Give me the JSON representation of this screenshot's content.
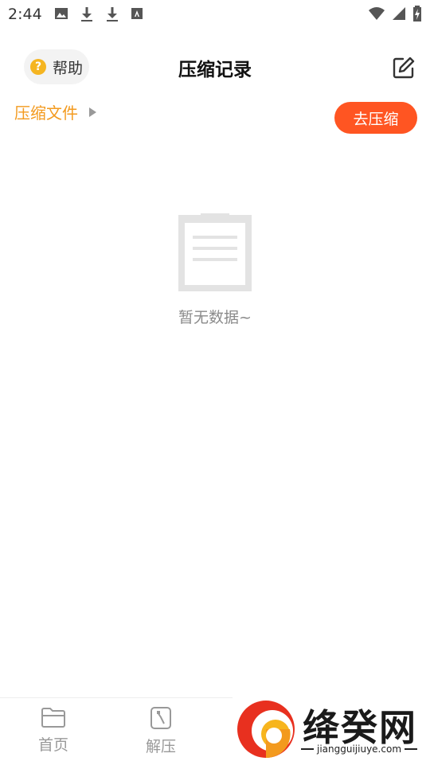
{
  "status_bar": {
    "time": "2:44",
    "left_icons": [
      "image-icon",
      "download-icon",
      "download-icon",
      "font-icon"
    ],
    "right_icons": [
      "wifi-icon",
      "signal-icon",
      "battery-charging-icon"
    ]
  },
  "header": {
    "help_label": "帮助",
    "title": "压缩记录",
    "edit_icon": "edit-icon"
  },
  "file_row": {
    "label": "压缩文件",
    "action_label": "去压缩"
  },
  "empty_state": {
    "icon": "clipboard-icon",
    "text": "暂无数据~"
  },
  "bottom_nav": {
    "items": [
      {
        "label": "首页",
        "icon": "folder-icon"
      },
      {
        "label": "解压",
        "icon": "unzip-icon"
      }
    ]
  },
  "watermark": {
    "text": "绛癸网",
    "url": "jiangguijiuye.com"
  },
  "colors": {
    "accent_orange": "#f39a1e",
    "button_red": "#ff5522",
    "help_yellow": "#f5b521",
    "muted_gray": "#8a8a8a"
  }
}
